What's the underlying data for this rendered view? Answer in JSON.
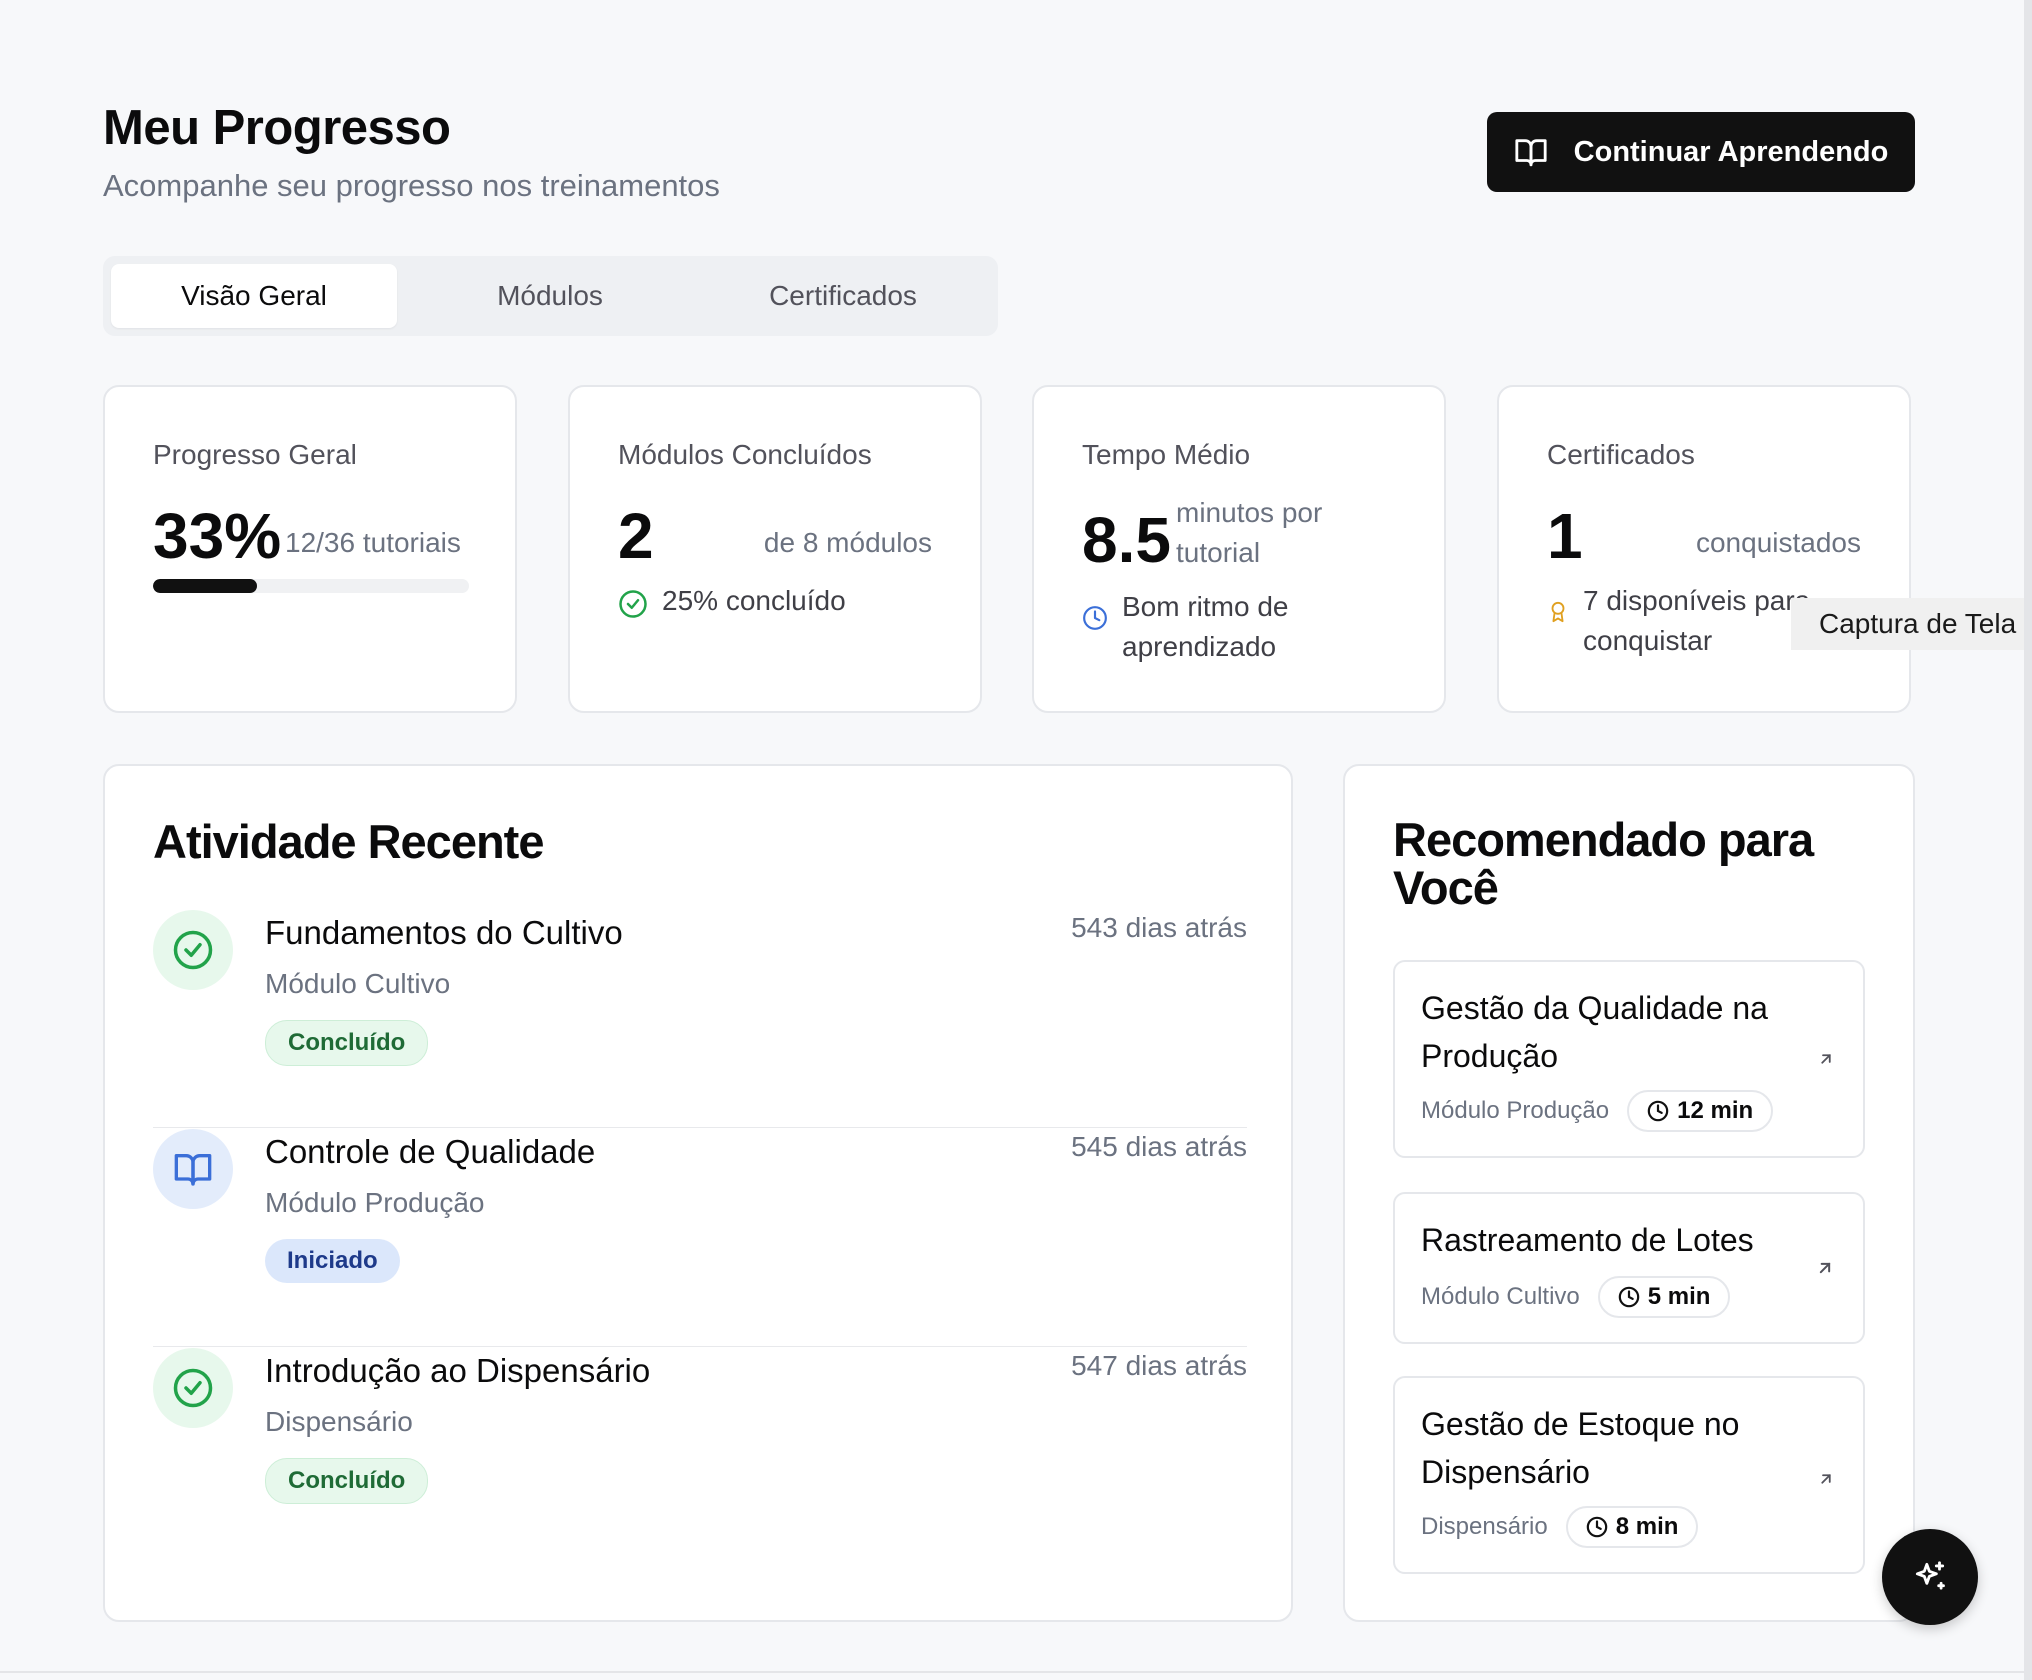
{
  "header": {
    "title": "Meu Progresso",
    "subtitle": "Acompanhe seu progresso nos treinamentos",
    "cta_label": "Continuar Aprendendo"
  },
  "tabs": [
    {
      "label": "Visão Geral",
      "active": true
    },
    {
      "label": "Módulos",
      "active": false
    },
    {
      "label": "Certificados",
      "active": false
    }
  ],
  "stats": {
    "progress": {
      "label": "Progresso Geral",
      "value": "33%",
      "suffix": "12/36 tutoriais",
      "fraction": 0.33
    },
    "modules": {
      "label": "Módulos Concluídos",
      "value": "2",
      "suffix": "de 8 módulos",
      "note": "25% concluído"
    },
    "time": {
      "label": "Tempo Médio",
      "value": "8.5",
      "suffix_line1": "minutos por",
      "suffix_line2": "tutorial",
      "note_line1": "Bom ritmo de",
      "note_line2": "aprendizado"
    },
    "certs": {
      "label": "Certificados",
      "value": "1",
      "suffix": "conquistados",
      "note_line1": "7 disponíveis para",
      "note_line2": "conquistar"
    }
  },
  "activity": {
    "title": "Atividade Recente",
    "items": [
      {
        "title": "Fundamentos do Cultivo",
        "module": "Módulo Cultivo",
        "status": "Concluído",
        "time": "543 dias atrás",
        "icon": "check-circle-icon"
      },
      {
        "title": "Controle de Qualidade",
        "module": "Módulo Produção",
        "status": "Iniciado",
        "time": "545 dias atrás",
        "icon": "book-open-icon"
      },
      {
        "title": "Introdução ao Dispensário",
        "module": "Dispensário",
        "status": "Concluído",
        "time": "547 dias atrás",
        "icon": "check-circle-icon"
      }
    ]
  },
  "recommended": {
    "title_line1": "Recomendado para",
    "title_line2": "Você",
    "items": [
      {
        "title_line1": "Gestão da Qualidade na",
        "title_line2": "Produção",
        "module": "Módulo Produção",
        "duration": "12 min"
      },
      {
        "title_line1": "Rastreamento de Lotes",
        "title_line2": "",
        "module": "Módulo Cultivo",
        "duration": "5 min"
      },
      {
        "title_line1": "Gestão de Estoque no",
        "title_line2": "Dispensário",
        "module": "Dispensário",
        "duration": "8 min"
      }
    ]
  },
  "tooltip": "Captura de Tela",
  "colors": {
    "accent": "#111111",
    "success": "#22a34a",
    "info": "#3b6fd8",
    "award": "#e0a020"
  }
}
